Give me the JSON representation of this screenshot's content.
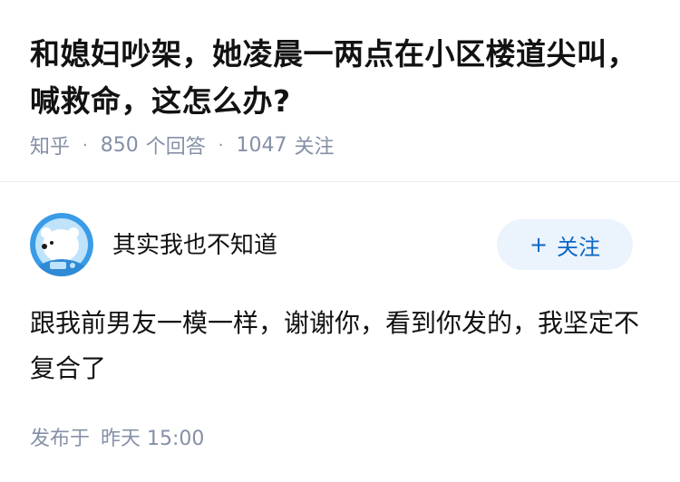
{
  "question": {
    "title": "和媳妇吵架，她凌晨一两点在小区楼道尖叫，喊救命，这怎么办?",
    "source": "知乎",
    "answers_count": "850",
    "answers_label": "个回答",
    "followers_count": "1047",
    "followers_label": "关注"
  },
  "answer": {
    "author": "其实我也不知道",
    "avatar_icon": "polar-bear-astronaut-avatar",
    "follow_button": {
      "icon": "+",
      "label": "关注"
    },
    "content": "跟我前男友一模一样，谢谢你，看到你发的，我坚定不复合了",
    "published_label": "发布于",
    "published_time": "昨天 15:00"
  },
  "colors": {
    "meta_text": "#8590a6",
    "follow_bg": "#ebf3fd",
    "follow_text": "#0a66c2"
  }
}
